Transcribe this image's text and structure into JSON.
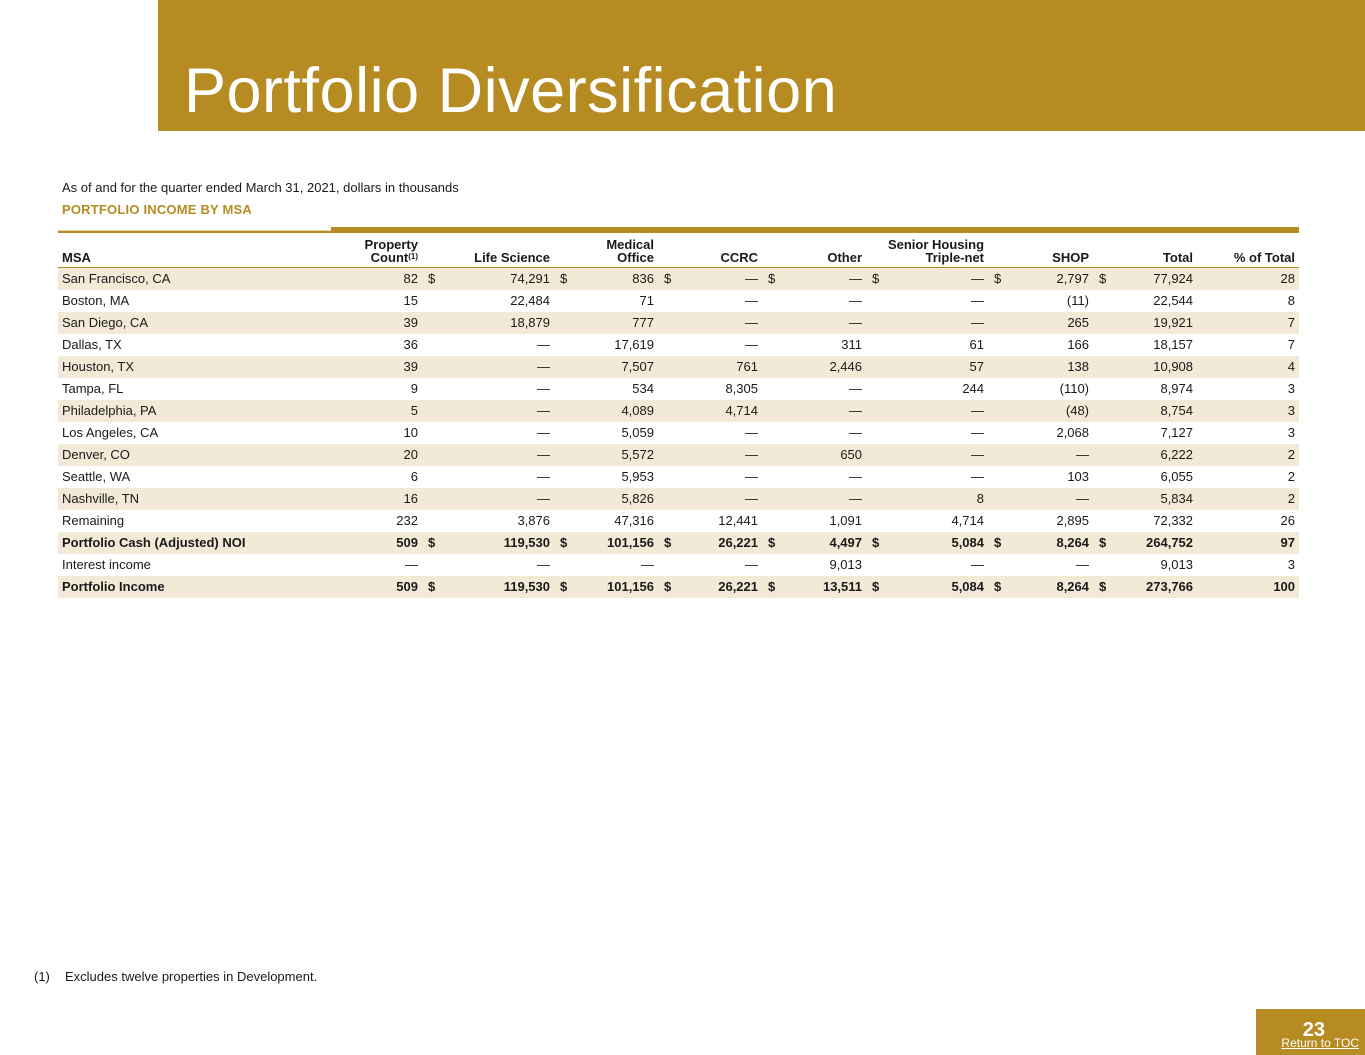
{
  "header": {
    "title": "Portfolio Diversification"
  },
  "subtitle": "As of and for the quarter ended March 31, 2021, dollars in thousands",
  "section_title": "PORTFOLIO INCOME BY MSA",
  "table": {
    "headers": {
      "msa": "MSA",
      "property_count_line1": "Property",
      "property_count_line2": "Count",
      "property_count_sup": "(1)",
      "life_science": "Life Science",
      "medical_office_line1": "Medical",
      "medical_office_line2": "Office",
      "ccrc": "CCRC",
      "other": "Other",
      "shtn_line1": "Senior Housing",
      "shtn_line2": "Triple-net",
      "shop": "SHOP",
      "total": "Total",
      "pct_total": "% of Total"
    },
    "rows": [
      {
        "msa": "San Francisco, CA",
        "count": "82",
        "c1": "$",
        "ls": "74,291",
        "c2": "$",
        "mo": "836",
        "c3": "$",
        "ccrc": "—",
        "c4": "$",
        "other": "—",
        "c5": "$",
        "shtn": "—",
        "c6": "$",
        "shop": "2,797",
        "c7": "$",
        "total": "77,924",
        "pct": "28"
      },
      {
        "msa": "Boston, MA",
        "count": "15",
        "c1": "",
        "ls": "22,484",
        "c2": "",
        "mo": "71",
        "c3": "",
        "ccrc": "—",
        "c4": "",
        "other": "—",
        "c5": "",
        "shtn": "—",
        "c6": "",
        "shop": "(11)",
        "c7": "",
        "total": "22,544",
        "pct": "8"
      },
      {
        "msa": "San Diego, CA",
        "count": "39",
        "c1": "",
        "ls": "18,879",
        "c2": "",
        "mo": "777",
        "c3": "",
        "ccrc": "—",
        "c4": "",
        "other": "—",
        "c5": "",
        "shtn": "—",
        "c6": "",
        "shop": "265",
        "c7": "",
        "total": "19,921",
        "pct": "7"
      },
      {
        "msa": "Dallas, TX",
        "count": "36",
        "c1": "",
        "ls": "—",
        "c2": "",
        "mo": "17,619",
        "c3": "",
        "ccrc": "—",
        "c4": "",
        "other": "311",
        "c5": "",
        "shtn": "61",
        "c6": "",
        "shop": "166",
        "c7": "",
        "total": "18,157",
        "pct": "7"
      },
      {
        "msa": "Houston, TX",
        "count": "39",
        "c1": "",
        "ls": "—",
        "c2": "",
        "mo": "7,507",
        "c3": "",
        "ccrc": "761",
        "c4": "",
        "other": "2,446",
        "c5": "",
        "shtn": "57",
        "c6": "",
        "shop": "138",
        "c7": "",
        "total": "10,908",
        "pct": "4"
      },
      {
        "msa": "Tampa, FL",
        "count": "9",
        "c1": "",
        "ls": "—",
        "c2": "",
        "mo": "534",
        "c3": "",
        "ccrc": "8,305",
        "c4": "",
        "other": "—",
        "c5": "",
        "shtn": "244",
        "c6": "",
        "shop": "(110)",
        "c7": "",
        "total": "8,974",
        "pct": "3"
      },
      {
        "msa": "Philadelphia, PA",
        "count": "5",
        "c1": "",
        "ls": "—",
        "c2": "",
        "mo": "4,089",
        "c3": "",
        "ccrc": "4,714",
        "c4": "",
        "other": "—",
        "c5": "",
        "shtn": "—",
        "c6": "",
        "shop": "(48)",
        "c7": "",
        "total": "8,754",
        "pct": "3"
      },
      {
        "msa": "Los Angeles, CA",
        "count": "10",
        "c1": "",
        "ls": "—",
        "c2": "",
        "mo": "5,059",
        "c3": "",
        "ccrc": "—",
        "c4": "",
        "other": "—",
        "c5": "",
        "shtn": "—",
        "c6": "",
        "shop": "2,068",
        "c7": "",
        "total": "7,127",
        "pct": "3"
      },
      {
        "msa": "Denver, CO",
        "count": "20",
        "c1": "",
        "ls": "—",
        "c2": "",
        "mo": "5,572",
        "c3": "",
        "ccrc": "—",
        "c4": "",
        "other": "650",
        "c5": "",
        "shtn": "—",
        "c6": "",
        "shop": "—",
        "c7": "",
        "total": "6,222",
        "pct": "2"
      },
      {
        "msa": "Seattle, WA",
        "count": "6",
        "c1": "",
        "ls": "—",
        "c2": "",
        "mo": "5,953",
        "c3": "",
        "ccrc": "—",
        "c4": "",
        "other": "—",
        "c5": "",
        "shtn": "—",
        "c6": "",
        "shop": "103",
        "c7": "",
        "total": "6,055",
        "pct": "2"
      },
      {
        "msa": "Nashville, TN",
        "count": "16",
        "c1": "",
        "ls": "—",
        "c2": "",
        "mo": "5,826",
        "c3": "",
        "ccrc": "—",
        "c4": "",
        "other": "—",
        "c5": "",
        "shtn": "8",
        "c6": "",
        "shop": "—",
        "c7": "",
        "total": "5,834",
        "pct": "2"
      },
      {
        "msa": "Remaining",
        "count": "232",
        "c1": "",
        "ls": "3,876",
        "c2": "",
        "mo": "47,316",
        "c3": "",
        "ccrc": "12,441",
        "c4": "",
        "other": "1,091",
        "c5": "",
        "shtn": "4,714",
        "c6": "",
        "shop": "2,895",
        "c7": "",
        "total": "72,332",
        "pct": "26"
      },
      {
        "msa": "Portfolio Cash (Adjusted) NOI",
        "count": "509",
        "c1": "$",
        "ls": "119,530",
        "c2": "$",
        "mo": "101,156",
        "c3": "$",
        "ccrc": "26,221",
        "c4": "$",
        "other": "4,497",
        "c5": "$",
        "shtn": "5,084",
        "c6": "$",
        "shop": "8,264",
        "c7": "$",
        "total": "264,752",
        "pct": "97"
      },
      {
        "msa": "Interest income",
        "count": "—",
        "c1": "",
        "ls": "—",
        "c2": "",
        "mo": "—",
        "c3": "",
        "ccrc": "—",
        "c4": "",
        "other": "9,013",
        "c5": "",
        "shtn": "—",
        "c6": "",
        "shop": "—",
        "c7": "",
        "total": "9,013",
        "pct": "3"
      },
      {
        "msa": "Portfolio Income",
        "count": "509",
        "c1": "$",
        "ls": "119,530",
        "c2": "$",
        "mo": "101,156",
        "c3": "$",
        "ccrc": "26,221",
        "c4": "$",
        "other": "13,511",
        "c5": "$",
        "shtn": "5,084",
        "c6": "$",
        "shop": "8,264",
        "c7": "$",
        "total": "273,766",
        "pct": "100"
      }
    ]
  },
  "footnote": {
    "number": "(1)",
    "text": "Excludes twelve properties in Development."
  },
  "footer": {
    "page_number": "23",
    "toc_link": "Return to TOC"
  },
  "colors": {
    "brand_gold": "#b68b21",
    "row_shade": "#f2ead6"
  }
}
